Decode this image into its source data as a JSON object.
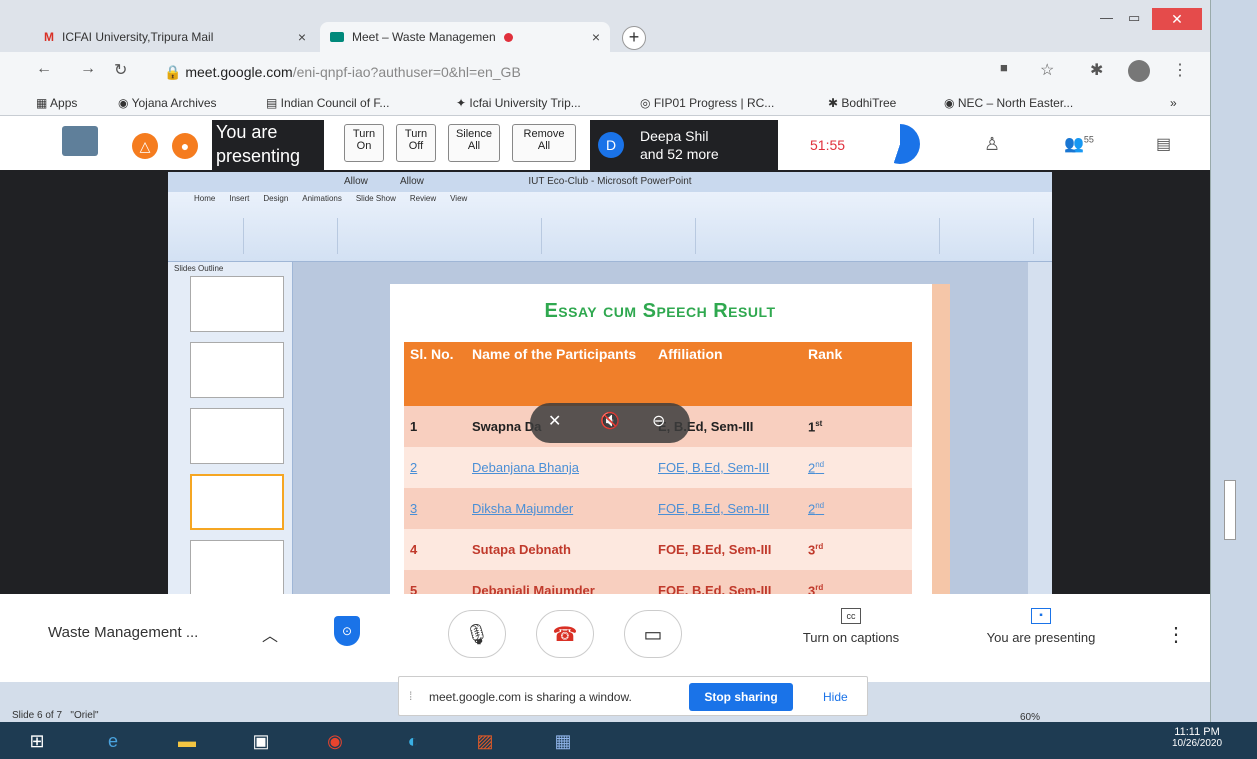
{
  "browser": {
    "tabs": [
      {
        "label": "ICFAI University,Tripura Mail",
        "icon": "gmail-icon"
      },
      {
        "label": "Meet – Waste Managemen",
        "icon": "meet-icon"
      }
    ],
    "url_host": "meet.google.com",
    "url_path": "/eni-qnpf-iao?authuser=0&hl=en_GB",
    "bookmarks": [
      "Apps",
      "Yojana Archives",
      "Indian Council of F...",
      "Icfai University Trip...",
      "FIP01 Progress | RC...",
      "BodhiTree",
      "NEC – North Easter..."
    ]
  },
  "meet_top": {
    "presenting_text": "You are presenting",
    "buttons": [
      {
        "line1": "Turn",
        "line2": "On"
      },
      {
        "line1": "Turn",
        "line2": "Off"
      },
      {
        "line1": "Silence",
        "line2": "All"
      },
      {
        "line1": "Remove",
        "line2": "All"
      }
    ],
    "participant_initial": "D",
    "participant_line1": "Deepa Shil",
    "participant_line2": "and 52 more",
    "timer": "51:55",
    "people_count": "55"
  },
  "powerpoint": {
    "window_title": "IUT Eco-Club - Microsoft PowerPoint",
    "allow1": "Allow",
    "allow2": "Allow",
    "ribbon_tabs": [
      "Home",
      "Insert",
      "Design",
      "Animations",
      "Slide Show",
      "Review",
      "View"
    ],
    "panel_tabs": [
      "Slides",
      "Outline"
    ],
    "status_slide": "Slide 6 of 7",
    "status_theme": "\"Oriel\"",
    "zoom": "60%"
  },
  "slide": {
    "title": "Essay cum Speech Result",
    "headers": [
      "Sl. No.",
      "Name of the Participants",
      "Affiliation",
      "Rank"
    ],
    "rows": [
      {
        "no": "1",
        "name": "Swapna Da",
        "aff": "E, B.Ed, Sem-III",
        "rank": "1",
        "sup": "st"
      },
      {
        "no": "2",
        "name": "Debanjana Bhanja",
        "aff": "FOE, B.Ed, Sem-III",
        "rank": "2",
        "sup": "nd"
      },
      {
        "no": "3",
        "name": "Diksha Majumder",
        "aff": "FOE, B.Ed, Sem-III",
        "rank": "2",
        "sup": "nd"
      },
      {
        "no": "4",
        "name": "Sutapa Debnath",
        "aff": "FOE, B.Ed, Sem-III",
        "rank": "3",
        "sup": "rd"
      },
      {
        "no": "5",
        "name": "Debanjali Majumder",
        "aff": "FOE, B.Ed, Sem-III",
        "rank": "3",
        "sup": "rd"
      }
    ]
  },
  "meet_bottom": {
    "meeting_name": "Waste Management ...",
    "captions_label": "Turn on captions",
    "presenting_label": "You are presenting"
  },
  "share_banner": {
    "text": "meet.google.com is sharing a window.",
    "stop_label": "Stop sharing",
    "hide_label": "Hide"
  },
  "taskbar": {
    "time": "11:11 PM",
    "date": "10/26/2020"
  }
}
